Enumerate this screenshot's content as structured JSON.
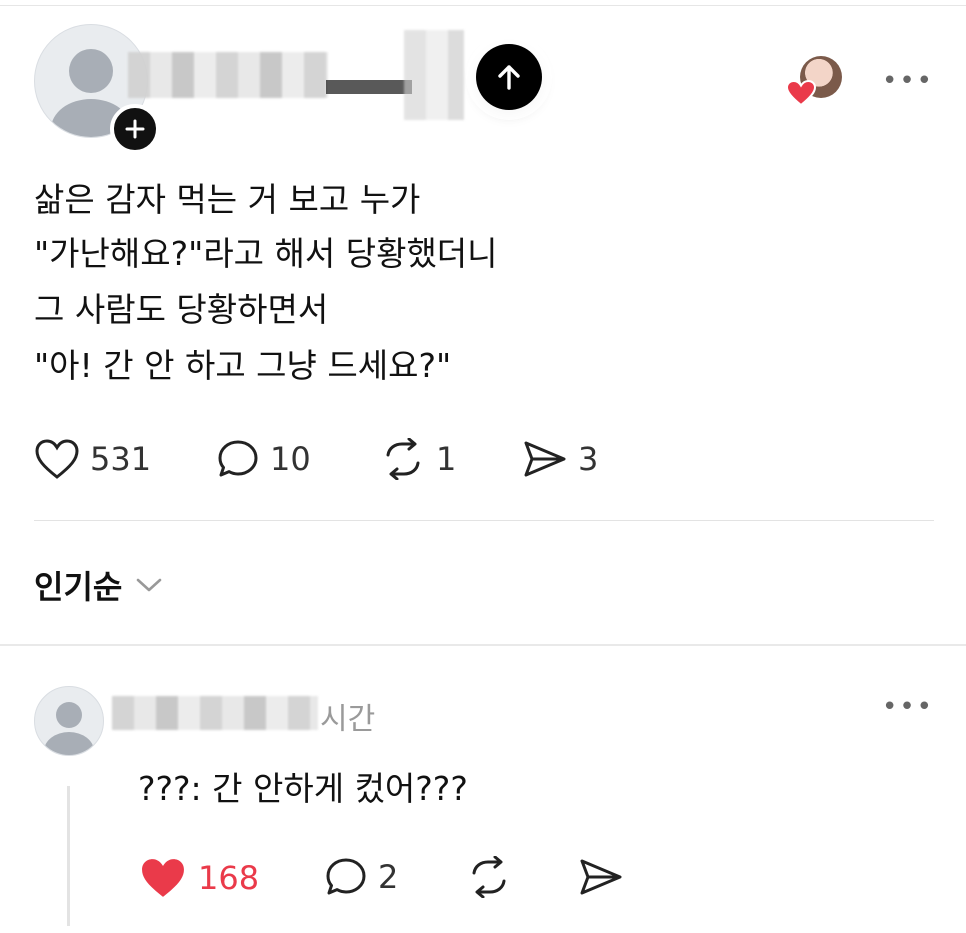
{
  "post": {
    "text_lines": [
      "삶은 감자 먹는 거 보고 누가",
      "\"가난해요?\"라고 해서 당황했더니",
      "그 사람도 당황하면서",
      "\"아! 간 안 하고 그냥 드세요?\""
    ],
    "likes": "531",
    "comments": "10",
    "reposts": "1",
    "shares": "3",
    "more_label": "•••"
  },
  "sort": {
    "label": "인기순"
  },
  "comment": {
    "time": "시간",
    "text": "???: 간 안하게 컸어???",
    "likes": "168",
    "replies": "2",
    "more_label": "•••"
  },
  "colors": {
    "liked_red": "#ea3a4a",
    "text": "#111111",
    "muted": "#999999"
  }
}
